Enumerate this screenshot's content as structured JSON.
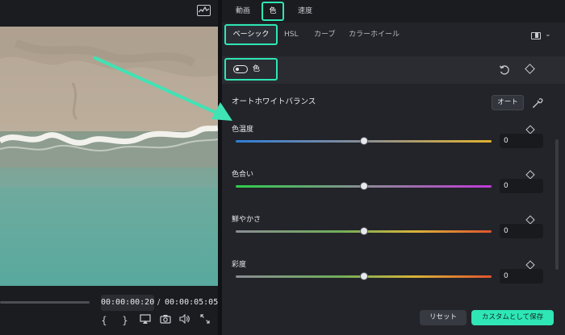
{
  "preview": {
    "timecode_current": "00:00:00:20",
    "timecode_separator": "/",
    "timecode_total": "00:00:05:05",
    "controls": {
      "mark_in_glyph": "{",
      "mark_out_glyph": "}"
    }
  },
  "tabs": {
    "animation": "動画",
    "color": "色",
    "speed": "速度"
  },
  "subtabs": {
    "basic": "ベーシック",
    "hsl": "HSL",
    "curves": "カーブ",
    "color_wheel": "カラーホイール"
  },
  "color_section": {
    "toggle_label": "色",
    "toggle_on": true
  },
  "auto_white_balance": {
    "label": "オートホワイトバランス",
    "button": "オート"
  },
  "sliders": [
    {
      "label": "色温度",
      "value": "0",
      "level": 0.5
    },
    {
      "label": "色合い",
      "value": "0",
      "level": 0.5
    },
    {
      "label": "鮮やかさ",
      "value": "0",
      "level": 0.5
    },
    {
      "label": "彩度",
      "value": "0",
      "level": 0.5
    }
  ],
  "footer": {
    "reset": "リセット",
    "save_custom": "カスタムとして保存"
  },
  "colors": {
    "accent": "#2fe6b5",
    "panel_bg": "#232429",
    "app_bg": "#1b1c20"
  }
}
